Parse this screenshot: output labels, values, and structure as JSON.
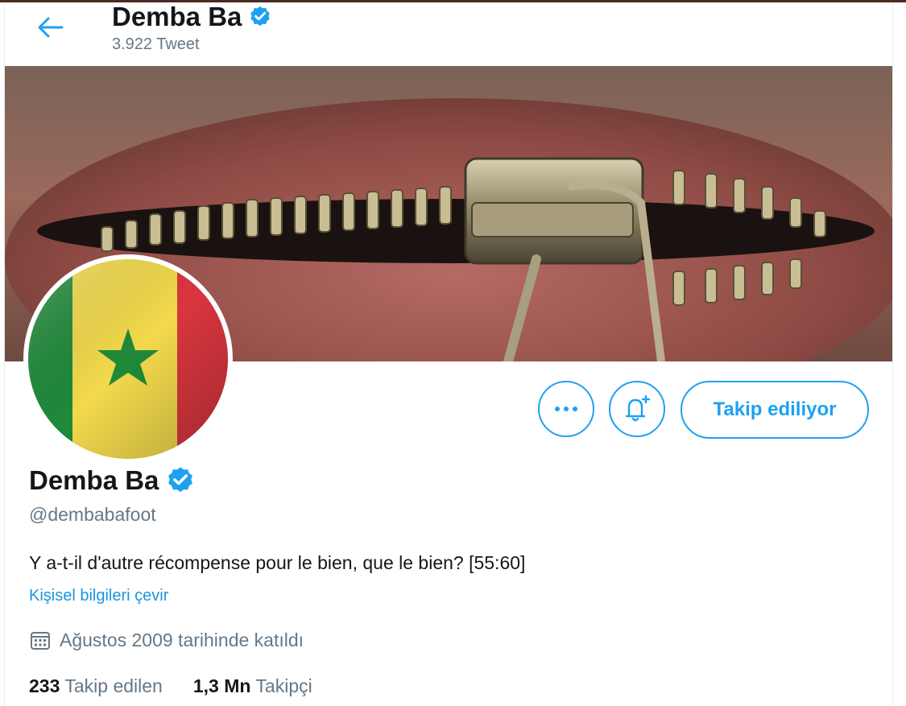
{
  "header": {
    "back_icon": "arrow-left-icon",
    "name": "Demba Ba",
    "tweet_count": "3.922 Tweet",
    "verified_icon": "verified-badge-icon"
  },
  "banner": {
    "description": "Zipper over mouth photograph"
  },
  "avatar": {
    "flag": "senegal-flag"
  },
  "actions": {
    "more_icon": "more-dots-icon",
    "bell_icon": "notification-bell-plus-icon",
    "follow_label": "Takip ediliyor"
  },
  "profile": {
    "name": "Demba Ba",
    "handle": "@dembabafoot",
    "bio": "Y a-t-il d'autre récompense pour le bien, que le bien? [55:60]",
    "translate_link": "Kişisel bilgileri çevir",
    "joined": "Ağustos 2009 tarihinde katıldı",
    "calendar_icon": "calendar-icon"
  },
  "stats": {
    "following_count": "233",
    "following_label": "Takip edilen",
    "followers_count": "1,3 Mn",
    "followers_label": "Takipçi"
  },
  "colors": {
    "accent": "#1da1f2",
    "text": "#14171a",
    "muted": "#657786",
    "link": "#1b95e0"
  }
}
